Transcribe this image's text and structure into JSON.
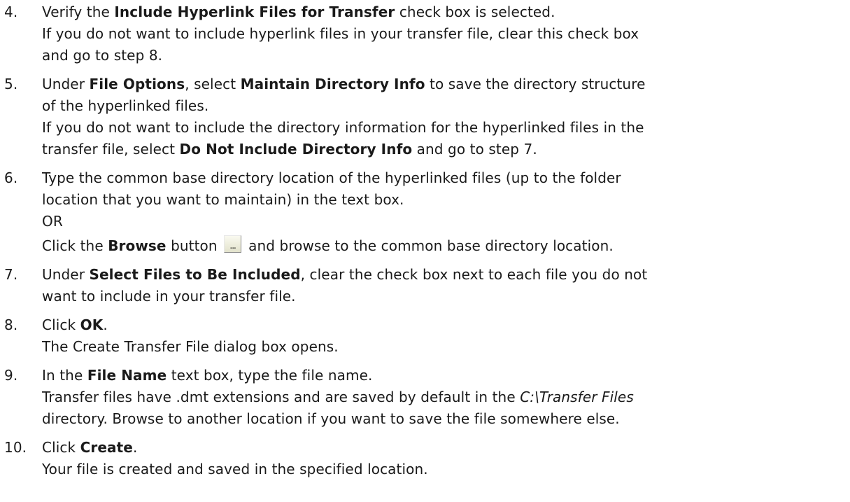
{
  "steps": [
    {
      "number": "4.",
      "lines": [
        [
          "Verify the ",
          "Include Hyperlink Files for Transfer",
          " check box is selected."
        ],
        [
          "If you do not want to include hyperlink files in your transfer file, clear this check box"
        ],
        [
          "and go to step 8."
        ]
      ]
    },
    {
      "number": "5.",
      "lines": [
        [
          "Under ",
          "File Options",
          ", select ",
          "Maintain Directory Info",
          " to save the directory structure"
        ],
        [
          "of the hyperlinked files."
        ],
        [
          "If you do not want to include the directory information for the hyperlinked files in the"
        ],
        [
          "transfer file, select ",
          "Do Not Include Directory Info",
          " and go to step 7."
        ]
      ]
    },
    {
      "number": "6.",
      "lines": [
        [
          "Type the common base directory location of the hyperlinked files (up to the folder"
        ],
        [
          "location that you want to maintain) in the text box."
        ],
        [
          "OR"
        ]
      ],
      "browse_line": {
        "prefix": "Click the ",
        "bold": "Browse",
        "mid": " button",
        "suffix": "and browse to the common base directory location.",
        "button_glyph": "..."
      }
    },
    {
      "number": "7.",
      "lines": [
        [
          "Under ",
          "Select Files to Be Included",
          ", clear the check box next to each file you do not"
        ],
        [
          "want to include in your transfer file."
        ]
      ]
    },
    {
      "number": "8.",
      "lines": [
        [
          "Click ",
          "OK",
          "."
        ],
        [
          "The Create Transfer File dialog box opens."
        ]
      ]
    },
    {
      "number": "9.",
      "lines": [
        [
          "In the ",
          "File Name",
          " text box, type the file name."
        ],
        [
          "Transfer files have .dmt extensions and are saved by default in the ",
          "C:\\Transfer Files"
        ],
        [
          "directory. Browse to another location if you want to save the file somewhere else."
        ]
      ],
      "italic_segments": [
        [
          1,
          1
        ]
      ]
    },
    {
      "number": "10.",
      "lines": [
        [
          "Click ",
          "Create",
          "."
        ],
        [
          "Your file is created and saved in the specified location."
        ]
      ]
    }
  ]
}
